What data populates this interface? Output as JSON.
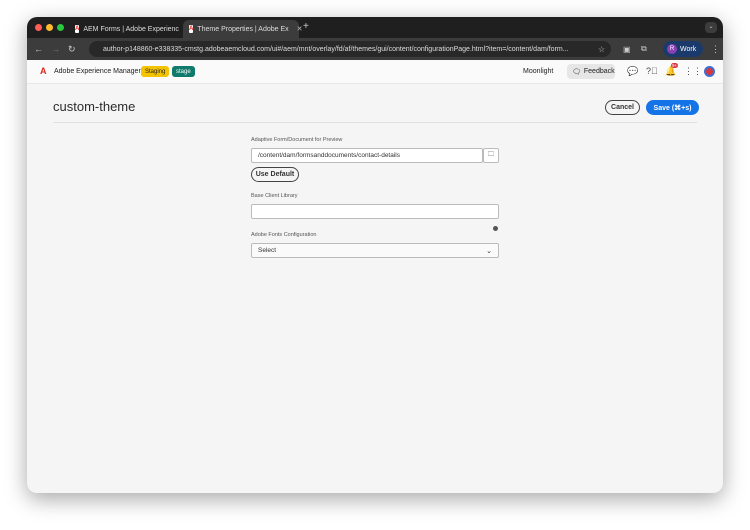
{
  "browser": {
    "tabs": [
      {
        "title": "AEM Forms | Adobe Experienc"
      },
      {
        "title": "Theme Properties | Adobe Ex"
      }
    ],
    "url": "author-p148860-e338335-cmstg.adobeaemcloud.com/ui#/aem/mnt/overlay/fd/af/themes/gui/content/configurationPage.html?item=/content/dam/form...",
    "profile_initial": "R",
    "profile_label": "Work"
  },
  "header": {
    "app_name": "Adobe Experience Manager",
    "badges": [
      "Staging",
      "stage"
    ],
    "org": "Moonlight",
    "feedback": "Feedback",
    "notification_count": "9+"
  },
  "page": {
    "title": "custom-theme",
    "cancel": "Cancel",
    "save": "Save (⌘+s)"
  },
  "form": {
    "preview_label": "Adaptive Form/Document for Preview",
    "preview_value": "/content/dam/formsanddocuments/contact-details",
    "use_default": "Use Default",
    "client_lib_label": "Base Client Library",
    "client_lib_value": "",
    "fonts_label": "Adobe Fonts Configuration",
    "fonts_value": "Select"
  }
}
